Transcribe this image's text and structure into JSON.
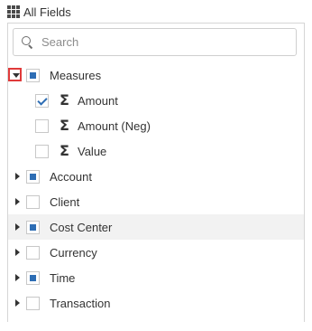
{
  "header": {
    "icon": "grid-icon",
    "label": "All Fields"
  },
  "search": {
    "placeholder": "Search",
    "icon": "search-icon"
  },
  "tree": {
    "measures": {
      "label": "Measures",
      "expanded": true,
      "checkbox": "partial",
      "children": [
        {
          "label": "Amount",
          "icon": "sigma-icon",
          "checked": true
        },
        {
          "label": "Amount (Neg)",
          "icon": "sigma-icon",
          "checked": false
        },
        {
          "label": "Value",
          "icon": "sigma-icon",
          "checked": false
        }
      ]
    },
    "dimensions": [
      {
        "label": "Account",
        "checkbox": "partial"
      },
      {
        "label": "Client",
        "checkbox": "empty"
      },
      {
        "label": "Cost Center",
        "checkbox": "partial",
        "highlighted": true
      },
      {
        "label": "Currency",
        "checkbox": "empty"
      },
      {
        "label": "Time",
        "checkbox": "partial"
      },
      {
        "label": "Transaction",
        "checkbox": "empty"
      }
    ]
  },
  "colors": {
    "accent": "#2d6db4",
    "highlight": "#f2f2f2",
    "expander_outline": "#e03a3a"
  }
}
